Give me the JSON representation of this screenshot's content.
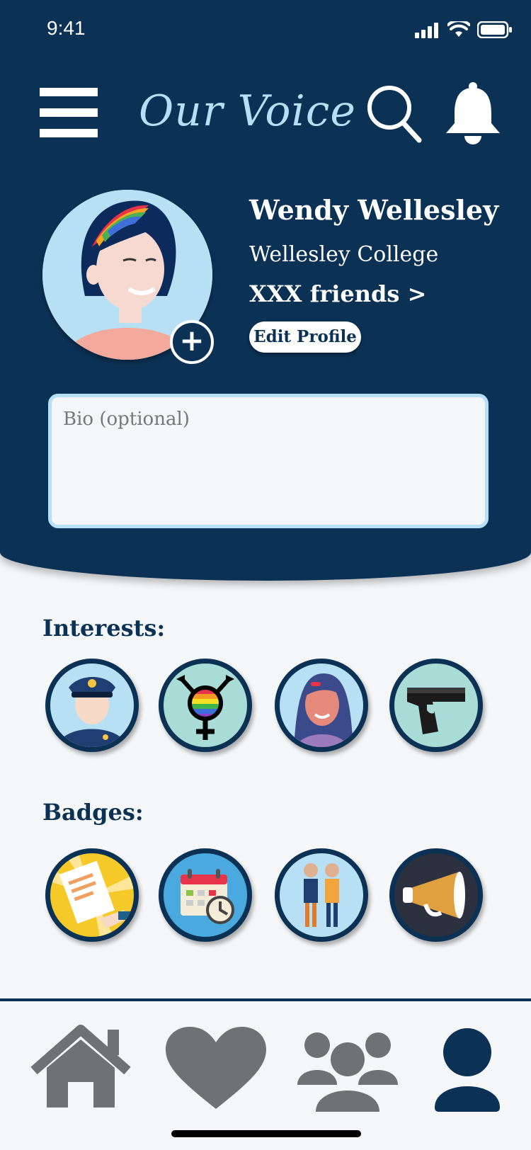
{
  "status_bar": {
    "time": "9:41"
  },
  "header": {
    "title": "Our Voice",
    "menu_icon": "menu-icon",
    "search_icon": "search-icon",
    "bell_icon": "bell-icon"
  },
  "profile": {
    "name": "Wendy Wellesley",
    "school": "Wellesley College",
    "friends_label": "XXX friends >",
    "edit_button": "Edit Profile",
    "avatar_add": "+"
  },
  "bio": {
    "placeholder": "Bio (optional)"
  },
  "interests": {
    "title": "Interests:",
    "items": [
      "police-officer-icon",
      "transgender-pride-icon",
      "woman-icon",
      "handgun-icon"
    ]
  },
  "badges": {
    "title": "Badges:",
    "items": [
      "petition-signing-icon",
      "calendar-clock-icon",
      "people-group-icon",
      "megaphone-icon"
    ]
  },
  "tab_bar": {
    "items": [
      "home-icon",
      "heart-icon",
      "group-icon",
      "profile-icon"
    ],
    "active": "profile-icon"
  },
  "colors": {
    "navy": "#0b3154",
    "light_blue": "#b6def4",
    "inactive_tab": "#6f7175",
    "background": "#f5f6f8"
  }
}
